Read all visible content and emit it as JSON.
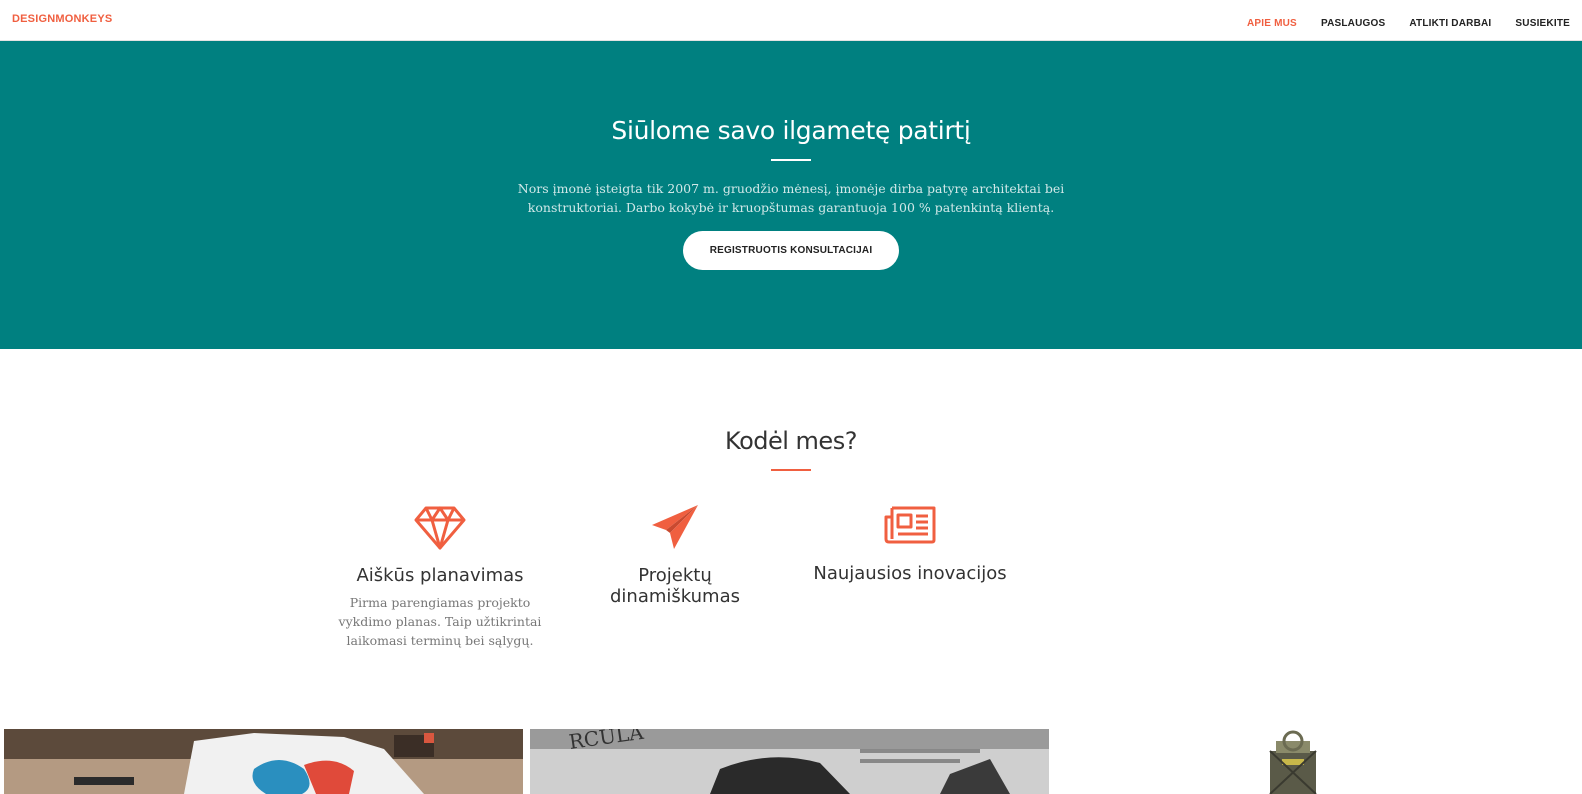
{
  "navbar": {
    "brand": "DESIGNMONKEYS",
    "items": [
      {
        "label": "APIE MUS",
        "active": true
      },
      {
        "label": "PASLAUGOS",
        "active": false
      },
      {
        "label": "ATLIKTI DARBAI",
        "active": false
      },
      {
        "label": "SUSIEKITE",
        "active": false
      }
    ]
  },
  "hero": {
    "title": "Siūlome savo ilgametę patirtį",
    "text": "Nors įmonė įsteigta tik 2007 m. gruodžio mėnesį, įmonėje dirba patyrę architektai bei konstruktoriai. Darbo kokybė ir kruopštumas garantuoja 100 % patenkintą klientą.",
    "button": "REGISTRUOTIS KONSULTACIJAI"
  },
  "why": {
    "title": "Kodėl mes?",
    "features": [
      {
        "icon": "diamond-icon",
        "title": "Aiškūs planavimas",
        "text": "Pirma parengiamas projekto vykdimo planas. Taip užtikrintai laikomasi terminų bei sąlygų."
      },
      {
        "icon": "paper-plane-icon",
        "title": "Projektų dinamiškumas",
        "text": ""
      },
      {
        "icon": "newspaper-icon",
        "title": "Naujausios inovacijos",
        "text": ""
      }
    ]
  },
  "colors": {
    "primary": "#f05f40",
    "hero_bg": "#008080",
    "text_dark": "#333333",
    "text_muted": "#777777"
  }
}
